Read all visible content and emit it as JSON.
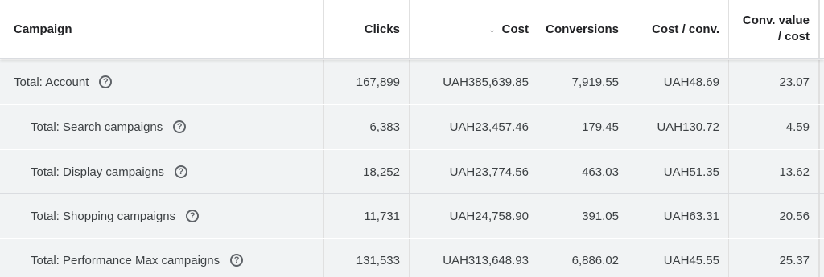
{
  "columns": {
    "campaign": "Campaign",
    "clicks": "Clicks",
    "cost_arrow": "↓",
    "cost": "Cost",
    "conversions": "Conversions",
    "cost_per_conv": "Cost / conv.",
    "conv_value_cost_line1": "Conv. value",
    "conv_value_cost_line2": "/ cost"
  },
  "rows": [
    {
      "name": "Total: Account",
      "clicks": "167,899",
      "cost": "UAH385,639.85",
      "conversions": "7,919.55",
      "cost_per_conv": "UAH48.69",
      "conv_value_cost": "23.07"
    },
    {
      "name": "Total: Search campaigns",
      "clicks": "6,383",
      "cost": "UAH23,457.46",
      "conversions": "179.45",
      "cost_per_conv": "UAH130.72",
      "conv_value_cost": "4.59"
    },
    {
      "name": "Total: Display campaigns",
      "clicks": "18,252",
      "cost": "UAH23,774.56",
      "conversions": "463.03",
      "cost_per_conv": "UAH51.35",
      "conv_value_cost": "13.62"
    },
    {
      "name": "Total: Shopping campaigns",
      "clicks": "11,731",
      "cost": "UAH24,758.90",
      "conversions": "391.05",
      "cost_per_conv": "UAH63.31",
      "conv_value_cost": "20.56"
    },
    {
      "name": "Total: Performance Max campaigns",
      "clicks": "131,533",
      "cost": "UAH313,648.93",
      "conversions": "6,886.02",
      "cost_per_conv": "UAH45.55",
      "conv_value_cost": "25.37"
    }
  ],
  "icons": {
    "help": "help-circle-icon",
    "sort": "arrow-down-icon"
  }
}
